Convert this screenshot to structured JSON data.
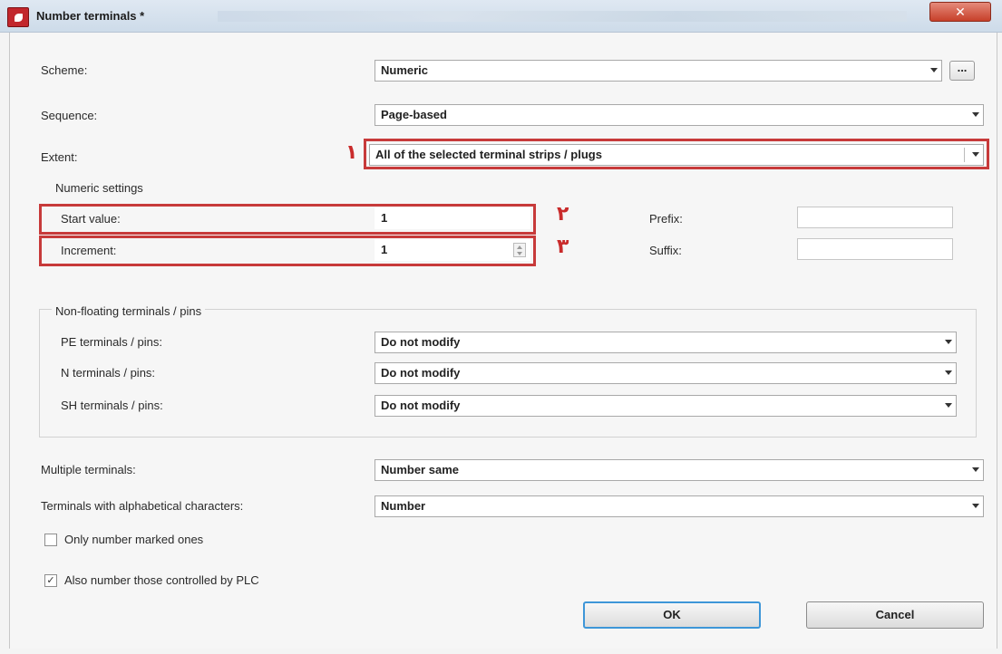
{
  "window": {
    "title": "Number terminals *",
    "close_glyph": "✕"
  },
  "scheme": {
    "label": "Scheme:",
    "value": "Numeric",
    "browse_label": "..."
  },
  "sequence": {
    "label": "Sequence:",
    "value": "Page-based"
  },
  "extent": {
    "label": "Extent:",
    "value": "All of the selected terminal strips / plugs",
    "marker": "۱"
  },
  "numeric_settings": {
    "title": "Numeric settings",
    "start_value": {
      "label": "Start value:",
      "value": "1",
      "marker": "۲"
    },
    "increment": {
      "label": "Increment:",
      "value": "1",
      "marker": "۳"
    },
    "prefix": {
      "label": "Prefix:",
      "value": ""
    },
    "suffix": {
      "label": "Suffix:",
      "value": ""
    }
  },
  "non_floating": {
    "title": "Non-floating terminals / pins",
    "pe": {
      "label": "PE terminals / pins:",
      "value": "Do not modify"
    },
    "n": {
      "label": "N terminals / pins:",
      "value": "Do not modify"
    },
    "sh": {
      "label": "SH terminals / pins:",
      "value": "Do not modify"
    }
  },
  "multiple_terminals": {
    "label": "Multiple terminals:",
    "value": "Number same"
  },
  "alpha_terminals": {
    "label": "Terminals with alphabetical characters:",
    "value": "Number"
  },
  "only_marked": {
    "label": "Only number marked ones",
    "checked": false
  },
  "plc_controlled": {
    "label": "Also number those controlled by PLC",
    "checked": true,
    "check_glyph": "✓"
  },
  "buttons": {
    "ok": "OK",
    "cancel": "Cancel"
  },
  "colors": {
    "annotation_red": "#c73a3a",
    "default_button_border": "#3e96d8"
  }
}
